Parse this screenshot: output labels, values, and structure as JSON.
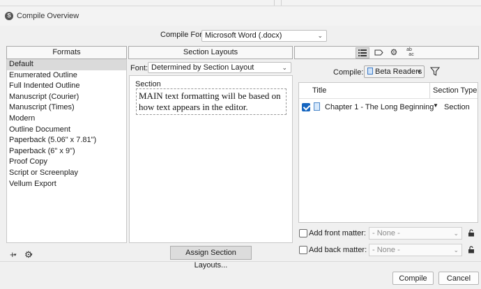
{
  "window": {
    "title": "Compile Overview"
  },
  "compile_for": {
    "label": "Compile For:",
    "value": "Microsoft Word (.docx)"
  },
  "formats": {
    "header": "Formats",
    "items": [
      {
        "label": "Default",
        "selected": true
      },
      {
        "label": "Enumerated Outline"
      },
      {
        "label": "Full Indented Outline"
      },
      {
        "label": "Manuscript (Courier)"
      },
      {
        "label": "Manuscript (Times)"
      },
      {
        "label": "Modern"
      },
      {
        "label": "Outline Document"
      },
      {
        "label": "Paperback (5.06\" x 7.81\")"
      },
      {
        "label": "Paperback (6\" x 9\")"
      },
      {
        "label": "Proof Copy"
      },
      {
        "label": "Script or Screenplay"
      },
      {
        "label": "Vellum Export"
      }
    ],
    "add_icon": "+",
    "settings_icon": "⚙"
  },
  "section_layouts": {
    "header": "Section Layouts",
    "font_label": "Font:",
    "font_value": "Determined by Section Layout",
    "section_label": "Section",
    "preview_text": "MAIN text formatting will be based on how text appears in the editor.",
    "assign_button": "Assign Section Layouts..."
  },
  "right_panel": {
    "toolbar_icons": [
      "list-icon",
      "label-icon",
      "gear-icon",
      "replacements-icon"
    ],
    "replacements_icon_top": "ab",
    "replacements_icon_bottom": "ac",
    "compile_label": "Compile:",
    "compile_group": "Beta Readers",
    "table": {
      "col_title": "Title",
      "col_type": "Section Type",
      "rows": [
        {
          "checked": true,
          "title": "Chapter 1 - The Long Beginning",
          "type": "Section"
        }
      ]
    },
    "front_matter": {
      "label": "Add front matter:",
      "value": "- None -",
      "checked": false
    },
    "back_matter": {
      "label": "Add back matter:",
      "value": "- None -",
      "checked": false
    }
  },
  "buttons": {
    "compile": "Compile",
    "cancel": "Cancel"
  },
  "colors": {
    "accent": "#1565c0",
    "selection": "#dadada"
  }
}
